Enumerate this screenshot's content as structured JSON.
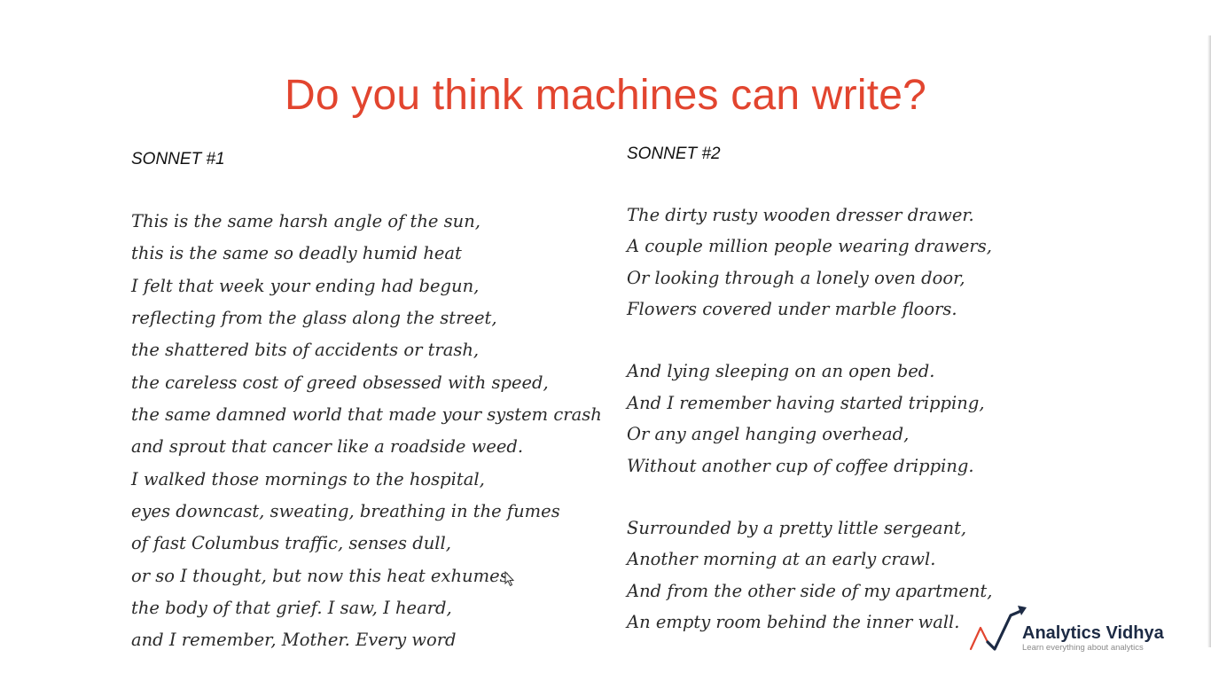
{
  "title": "Do you think machines can write?",
  "colors": {
    "title": "#e2452f",
    "text": "#2a2a2a",
    "logo_navy": "#1c2a44",
    "logo_red": "#e2452f"
  },
  "sonnet1": {
    "heading": "SONNET #1",
    "lines": [
      "This is the same harsh angle of the sun,",
      "this is the same so deadly humid heat",
      "I felt that week your ending had begun,",
      "reflecting from the glass along the street,",
      "the shattered bits of accidents or trash,",
      "the careless cost of greed obsessed with speed,",
      "the same damned world that made your system crash",
      "and sprout that cancer like a roadside weed.",
      "I walked those mornings to the hospital,",
      "eyes downcast, sweating, breathing in the fumes",
      "of fast Columbus traffic, senses dull,",
      "or so I thought, but now this heat exhumes",
      "the body of that grief. I saw, I heard,",
      "and I remember, Mother. Every word"
    ]
  },
  "sonnet2": {
    "heading": "SONNET #2",
    "lines": [
      "The dirty rusty wooden dresser drawer.",
      "A couple million people wearing drawers,",
      "Or looking through a lonely oven door,",
      "Flowers covered under marble floors.",
      "And lying sleeping on an open bed.",
      "And I remember having started tripping,",
      "Or any angel hanging overhead,",
      "Without another cup of coffee dripping.",
      "Surrounded by a pretty little sergeant,",
      "Another morning at an early crawl.",
      "And from the other side of my apartment,",
      "An empty room behind the inner wall."
    ]
  },
  "logo": {
    "name": "Analytics Vidhya",
    "tagline": "Learn everything about analytics",
    "icon": "analytics-vidhya-logo-icon"
  },
  "cursor_icon": "mouse-pointer-icon"
}
